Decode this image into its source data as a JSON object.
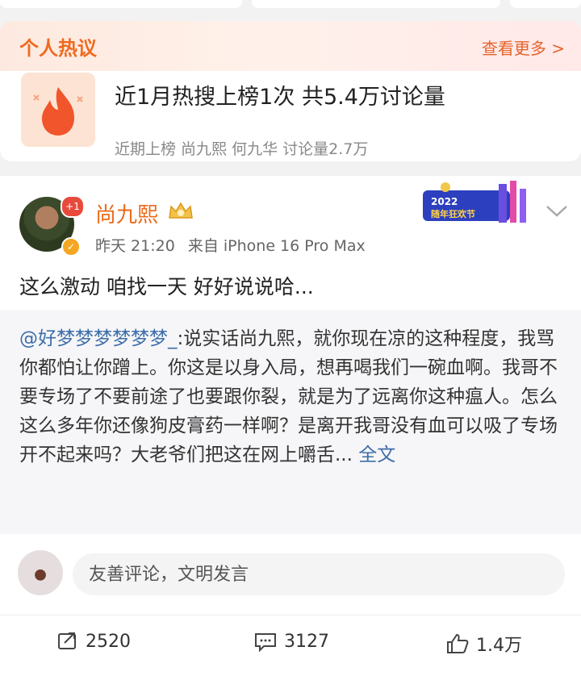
{
  "hot_topics": {
    "title": "个人热议",
    "see_more": "查看更多 >",
    "headline": "近1月热搜上榜1次 共5.4万讨论量",
    "sub": "近期上榜 尚九熙 何九华 讨论量2.7万"
  },
  "post": {
    "author": "尚九熙",
    "notification_count": "+1",
    "time": "昨天 21:20",
    "source": "来自 iPhone 16 Pro Max",
    "badge_text": "2022 随年狂欢节",
    "text": "这么激动 咱找一天 好好说说哈..."
  },
  "repost": {
    "mention": "@好梦梦梦梦梦梦_",
    "text": ":说实话尚九熙，就你现在凉的这种程度，我骂你都怕让你蹭上。你这是以身入局，想再喝我们一碗血啊。我哥不要专场了不要前途了也要跟你裂，就是为了远离你这种瘟人。怎么这么多年你还像狗皮膏药一样啊？是离开我哥没有血可以吸了专场开不起来吗？大老爷们把这在网上嚼舌...",
    "full_text": "全文"
  },
  "comment": {
    "placeholder": "友善评论，文明发言"
  },
  "actions": {
    "repost_count": "2520",
    "comment_count": "3127",
    "like_count": "1.4万"
  },
  "colors": {
    "accent_orange": "#ef6a1f",
    "link_blue": "#3d6ea8"
  }
}
